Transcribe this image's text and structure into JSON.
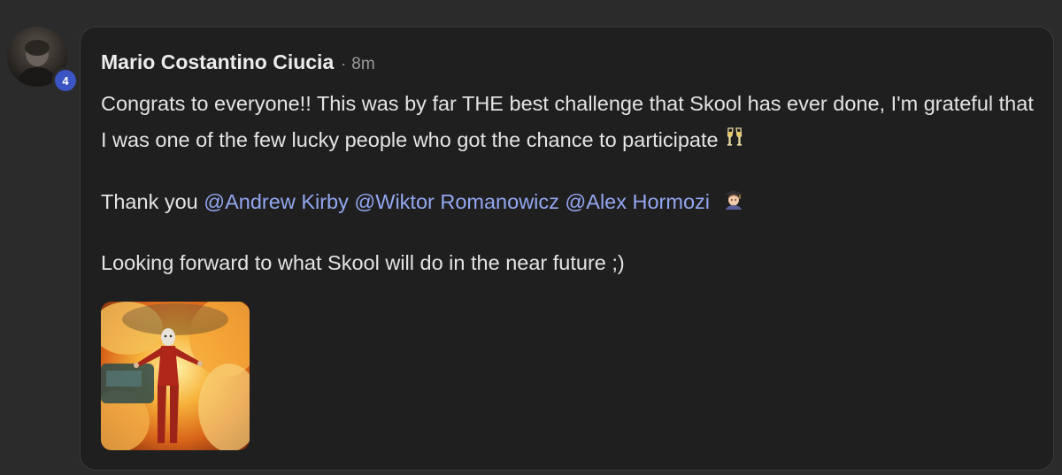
{
  "post": {
    "author": "Mario Costantino Ciucia",
    "separator": "·",
    "time": "8m",
    "level": "4",
    "line1": "Congrats to everyone!! This was by far THE best challenge that Skool has ever done, I'm grateful that I was one of the few lucky people who got the chance to participate",
    "line1_emoji": "champagne-glasses-emoji",
    "thanks_prefix": "Thank you",
    "mentions": [
      "@Andrew Kirby",
      "@Wiktor Romanowicz",
      "@Alex Hormozi"
    ],
    "thanks_emoji": "graduate-emoji",
    "line3": "Looking forward to what Skool will do in the near future ;)",
    "attachment_icon": "image-attachment"
  },
  "colors": {
    "background": "#2b2b2b",
    "card": "#1f1f20",
    "mention": "#93a7f0",
    "badge": "#3c55c4"
  }
}
